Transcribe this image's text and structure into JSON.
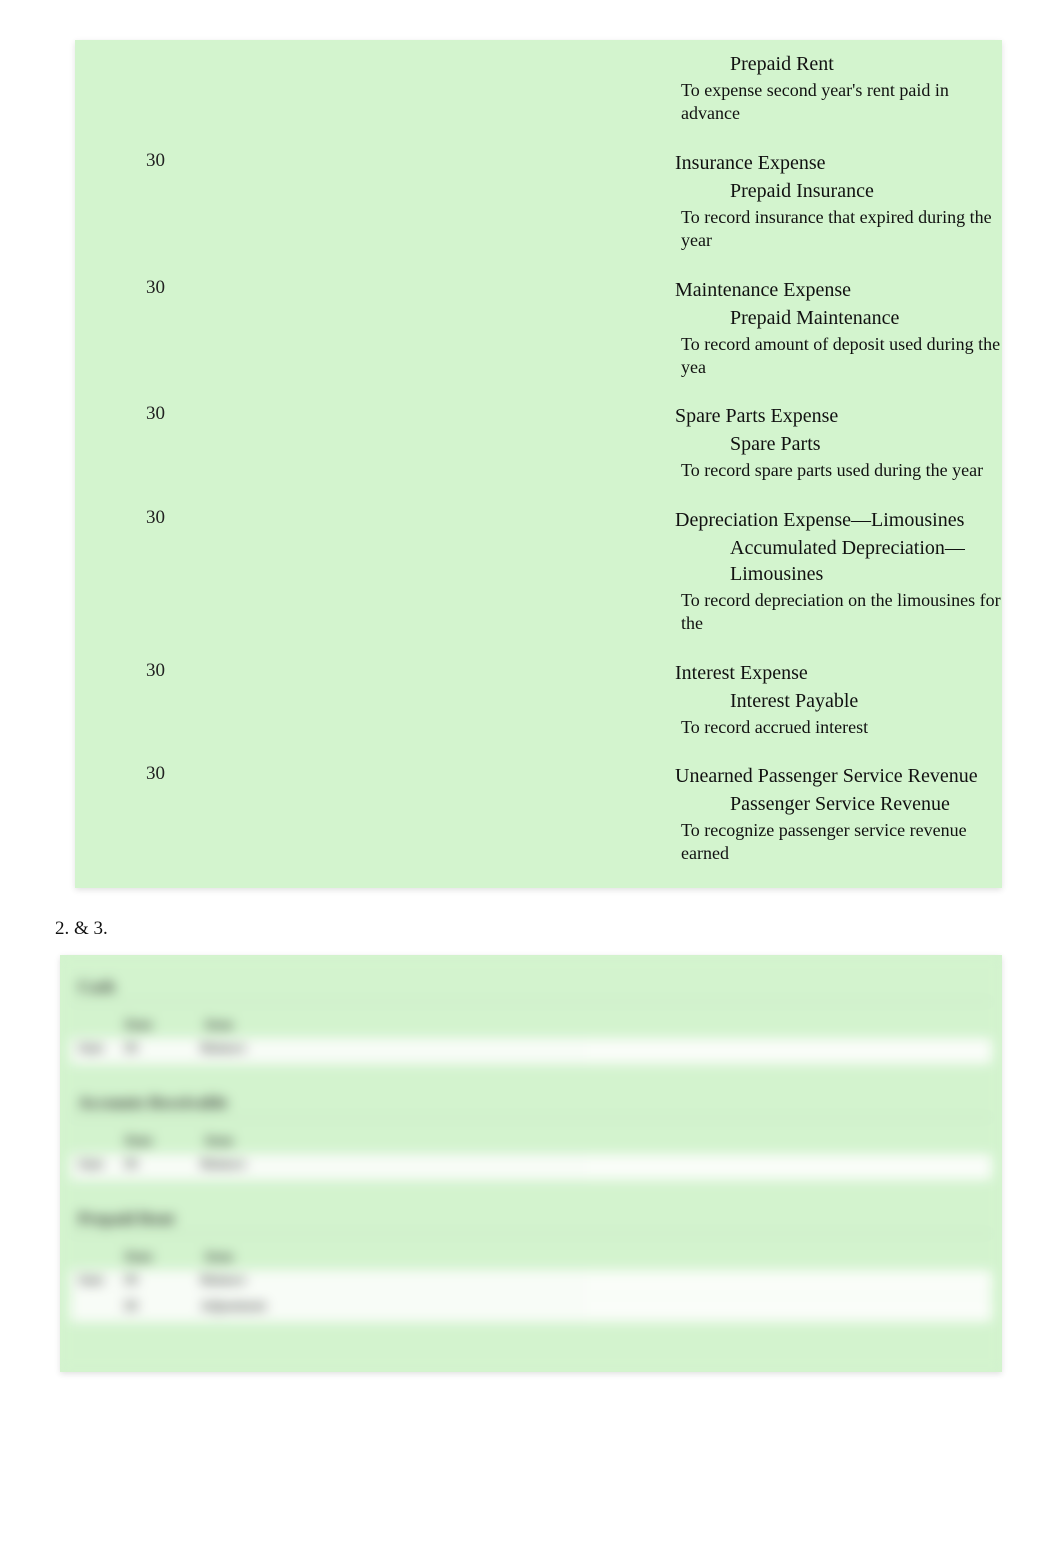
{
  "journal": {
    "entries": [
      {
        "day": "",
        "debit": "",
        "credit": "Prepaid Rent",
        "explanation": "To expense second year's rent paid in advance"
      },
      {
        "day": "30",
        "debit": "Insurance Expense",
        "credit": "Prepaid Insurance",
        "explanation": "To record insurance that expired during the year"
      },
      {
        "day": "30",
        "debit": "Maintenance Expense",
        "credit": "Prepaid Maintenance",
        "explanation": "To record amount of deposit used during the yea"
      },
      {
        "day": "30",
        "debit": "Spare Parts Expense",
        "credit": "Spare Parts",
        "explanation": "To record spare parts used during the year"
      },
      {
        "day": "30",
        "debit": "Depreciation Expense—Limousines",
        "credit": "Accumulated Depreciation—Limousines",
        "explanation": "To record depreciation on the limousines for the"
      },
      {
        "day": "30",
        "debit": "Interest Expense",
        "credit": "Interest Payable",
        "explanation": "To record accrued interest"
      },
      {
        "day": "30",
        "debit": "Unearned Passenger Service Revenue",
        "credit": "Passenger Service Revenue",
        "explanation": "To recognize passenger service revenue earned"
      }
    ]
  },
  "section_label": "2. & 3.",
  "ledger": {
    "accounts": [
      {
        "name": "Cash",
        "rows": [
          {
            "date": "June",
            "day": "30",
            "ref": "Balance"
          }
        ]
      },
      {
        "name": "Accounts Receivable",
        "rows": [
          {
            "date": "June",
            "day": "30",
            "ref": "Balance"
          }
        ]
      },
      {
        "name": "Prepaid Rent",
        "rows": [
          {
            "date": "June",
            "day": "30",
            "ref": "Balance"
          },
          {
            "date": "",
            "day": "30",
            "ref": "Adjustment"
          }
        ]
      }
    ],
    "header_date": "Date",
    "header_desc": "Item"
  }
}
